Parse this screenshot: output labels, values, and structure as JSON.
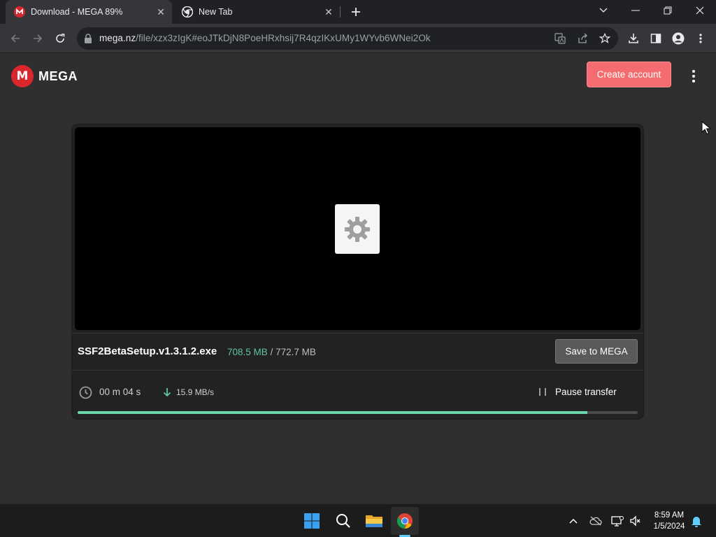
{
  "browser": {
    "tabs": [
      {
        "title": "Download - MEGA 89%",
        "active": true,
        "favicon": "mega-favicon"
      },
      {
        "title": "New Tab",
        "active": false,
        "favicon": "chrome-favicon"
      }
    ],
    "url_host": "mega.nz",
    "url_path": "/file/xzx3zIgK#eoJTkDjN8PoeHRxhsij7R4qzIKxUMy1WYvb6WNei2Ok"
  },
  "page": {
    "logo_letter": "M",
    "logo_text": "MEGA",
    "create_account_label": "Create account",
    "file": {
      "name": "SSF2BetaSetup.v1.3.1.2.exe",
      "downloaded": "708.5 MB",
      "separator": "/",
      "total": "772.7 MB"
    },
    "save_button_label": "Save to MEGA",
    "timer": "00 m  04 s",
    "speed": "15.9 MB/s",
    "pause_label": "Pause transfer",
    "progress_fraction": 0.91
  },
  "taskbar": {
    "time": "8:59 AM",
    "date": "1/5/2024"
  },
  "colors": {
    "accent_red": "#d9272e",
    "create_button": "#f46c6f",
    "progress_green": "#6ed6ad",
    "downloaded_text": "#5fc3a4"
  }
}
